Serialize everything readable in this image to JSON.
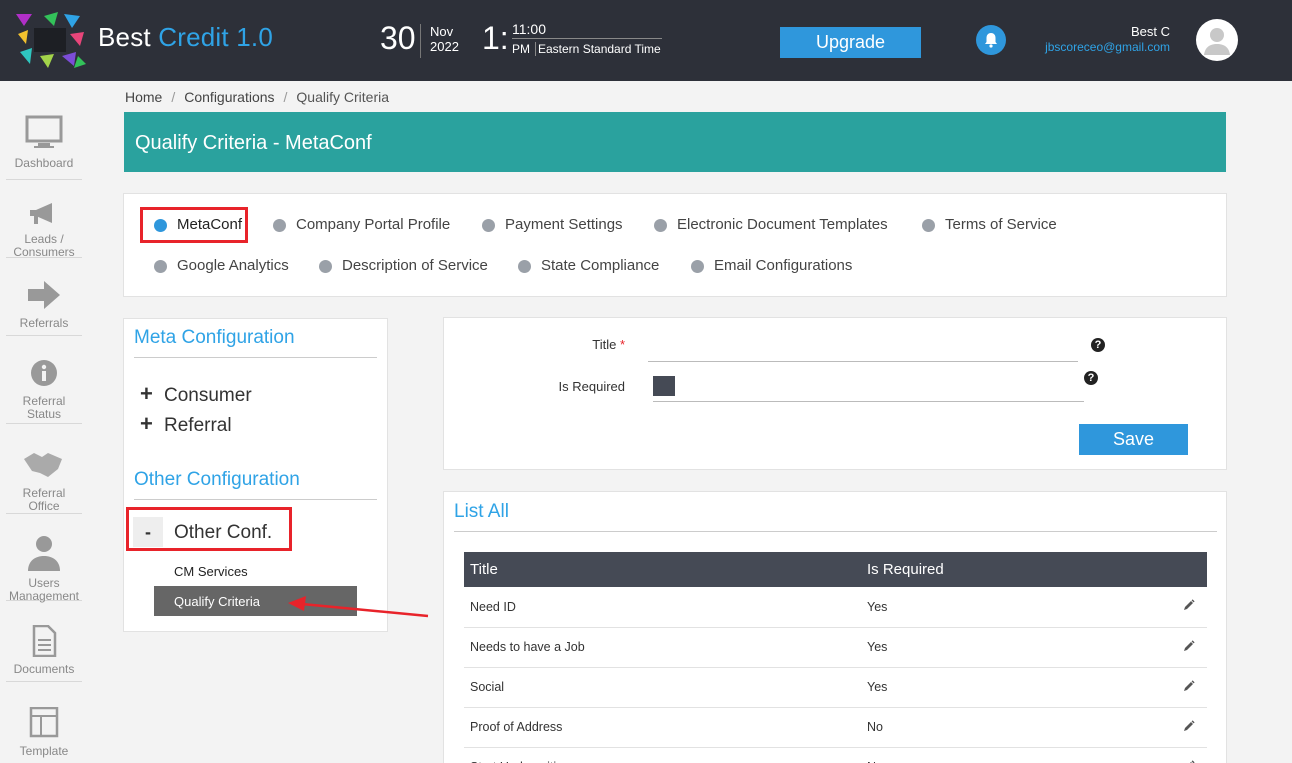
{
  "app": {
    "name_part1": "Best",
    "name_part2": "Credit 1.0"
  },
  "header": {
    "date_day": "30",
    "date_month": "Nov",
    "date_year": "2022",
    "time_hour": "1:",
    "time_minutes": "11:00",
    "time_ampm": "PM",
    "time_zone": "Eastern Standard Time",
    "upgrade_label": "Upgrade",
    "user_name": "Best C",
    "user_email": "jbscoreceo@gmail.com"
  },
  "sidebar": {
    "items": [
      {
        "label": "Dashboard",
        "icon": "monitor-icon"
      },
      {
        "label": "Leads / Consumers",
        "icon": "megaphone-icon"
      },
      {
        "label": "Referrals",
        "icon": "arrow-right-icon"
      },
      {
        "label": "Referral Status",
        "icon": "info-icon"
      },
      {
        "label": "Referral Office",
        "icon": "handshake-icon"
      },
      {
        "label": "Users Management",
        "icon": "user-icon"
      },
      {
        "label": "Documents",
        "icon": "document-icon"
      },
      {
        "label": "Template",
        "icon": "template-icon"
      }
    ]
  },
  "breadcrumb": {
    "home": "Home",
    "configurations": "Configurations",
    "current": "Qualify Criteria"
  },
  "banner": {
    "title": "Qualify Criteria - MetaConf"
  },
  "tabs": [
    {
      "label": "MetaConf",
      "active": true
    },
    {
      "label": "Company Portal Profile"
    },
    {
      "label": "Payment Settings"
    },
    {
      "label": "Electronic Document Templates"
    },
    {
      "label": "Terms of Service"
    },
    {
      "label": "Google Analytics"
    },
    {
      "label": "Description of Service"
    },
    {
      "label": "State Compliance"
    },
    {
      "label": "Email Configurations"
    }
  ],
  "config": {
    "meta_title": "Meta Configuration",
    "meta_items": [
      "Consumer",
      "Referral"
    ],
    "other_title": "Other Configuration",
    "other_toggle": "-",
    "other_label": "Other Conf.",
    "other_items": [
      "CM Services",
      "Qualify Criteria"
    ]
  },
  "form": {
    "title_label": "Title",
    "required_mark": "*",
    "is_required_label": "Is Required",
    "title_value": "",
    "save_label": "Save"
  },
  "list": {
    "title": "List All",
    "columns": [
      "Title",
      "Is Required"
    ],
    "rows": [
      {
        "title": "Need ID",
        "required": "Yes"
      },
      {
        "title": "Needs to have a Job",
        "required": "Yes"
      },
      {
        "title": "Social",
        "required": "Yes"
      },
      {
        "title": "Proof of Address",
        "required": "No"
      },
      {
        "title": "Start Underwriting",
        "required": "No"
      }
    ]
  },
  "colors": {
    "accent": "#2f97dc",
    "banner": "#2aa29e",
    "header_bg": "#2d3039",
    "highlight": "#e8232a"
  }
}
